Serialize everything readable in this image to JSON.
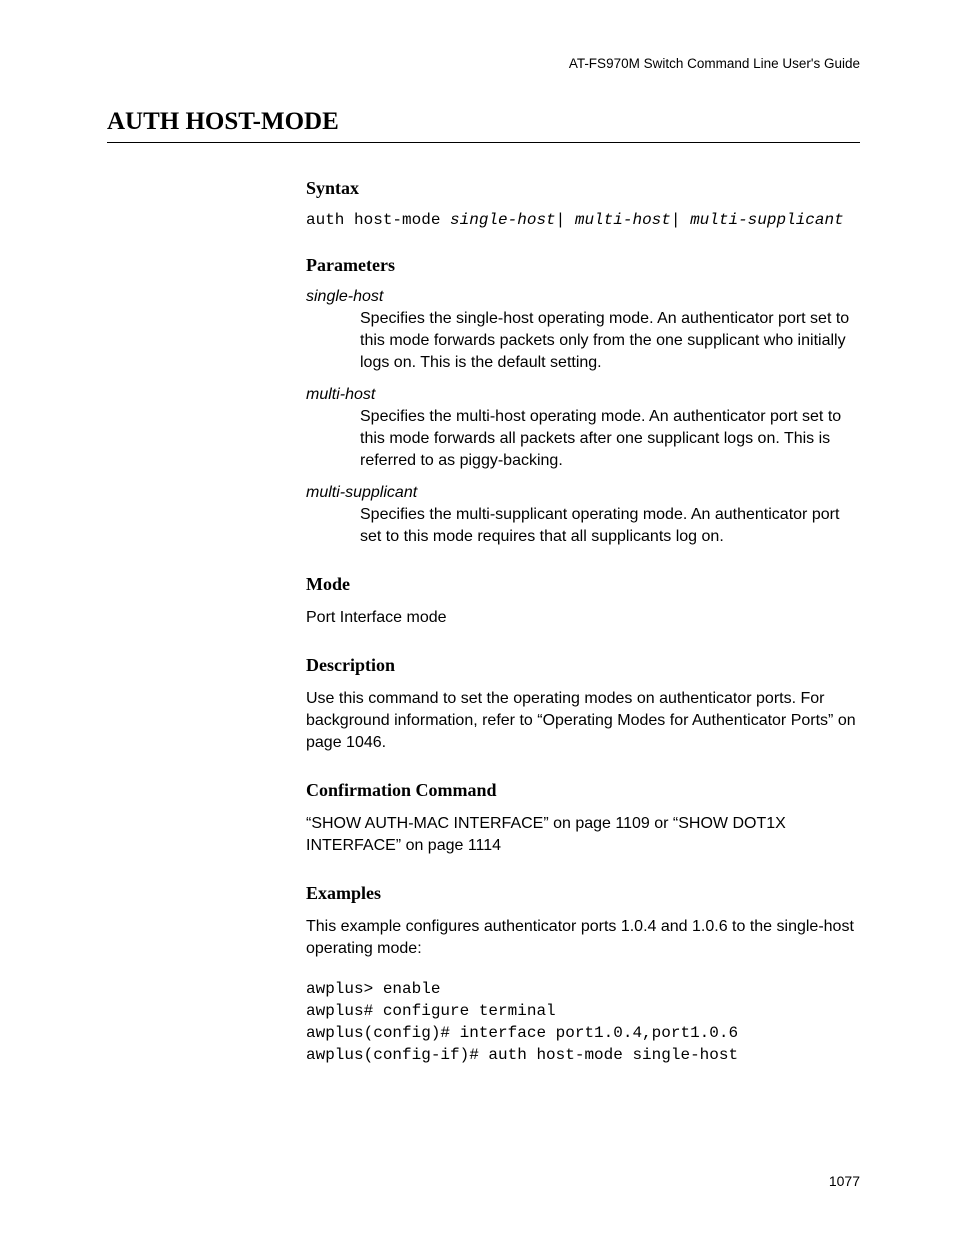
{
  "header": {
    "running": "AT-FS970M Switch Command Line User's Guide"
  },
  "title": "AUTH HOST-MODE",
  "syntax": {
    "heading": "Syntax",
    "cmd_prefix": "auth host-mode ",
    "cmd_args": "single-host| multi-host| multi-supplicant"
  },
  "parameters": {
    "heading": "Parameters",
    "items": [
      {
        "term": "single-host",
        "def": "Specifies the single-host operating mode. An authenticator port set to this mode forwards packets only from the one supplicant who initially logs on. This is the default setting."
      },
      {
        "term": "multi-host",
        "def": "Specifies the multi-host operating mode. An authenticator port set to this mode forwards all packets after one supplicant logs on. This is referred to as piggy-backing."
      },
      {
        "term": "multi-supplicant",
        "def": "Specifies the multi-supplicant operating mode. An authenticator port set to this mode requires that all supplicants log on."
      }
    ]
  },
  "mode": {
    "heading": "Mode",
    "text": "Port Interface mode"
  },
  "description": {
    "heading": "Description",
    "text": "Use this command to set the operating modes on authenticator ports. For background information, refer to “Operating Modes for Authenticator Ports” on page 1046."
  },
  "confirmation": {
    "heading": "Confirmation Command",
    "text": "“SHOW AUTH-MAC INTERFACE” on page 1109 or “SHOW DOT1X INTERFACE” on page 1114"
  },
  "examples": {
    "heading": "Examples",
    "intro": "This example configures authenticator ports 1.0.4 and 1.0.6 to the single-host operating mode:",
    "code": "awplus> enable\nawplus# configure terminal\nawplus(config)# interface port1.0.4,port1.0.6\nawplus(config-if)# auth host-mode single-host"
  },
  "footer": {
    "page_number": "1077"
  }
}
